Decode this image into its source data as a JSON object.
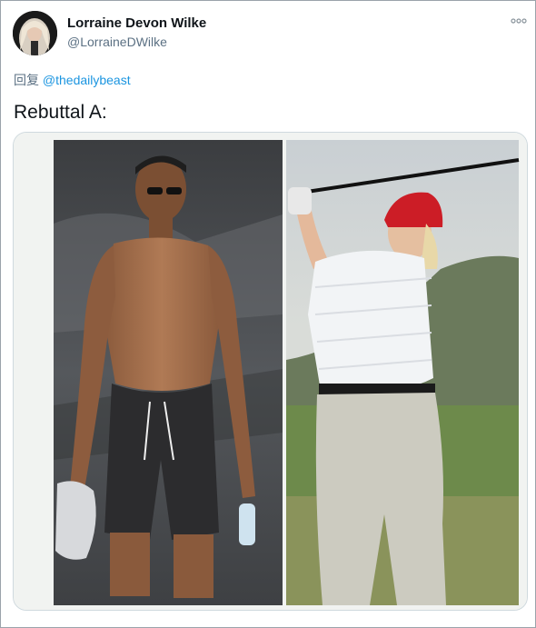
{
  "tweet": {
    "author": {
      "display_name": "Lorraine Devon Wilke",
      "handle": "@LorraineDWilke",
      "avatar_icon": "profile-photo"
    },
    "more_icon": "more-options-icon",
    "reply_prefix": "回复",
    "reply_to": "@thedailybeast",
    "text": "Rebuttal A:",
    "media": {
      "type": "photo",
      "panels": [
        "shirtless-man-walking",
        "man-golfing-red-cap"
      ]
    }
  },
  "colors": {
    "text_primary": "#0f1419",
    "text_secondary": "#5b7083",
    "link": "#1b95e0",
    "border": "#cfd9de"
  }
}
